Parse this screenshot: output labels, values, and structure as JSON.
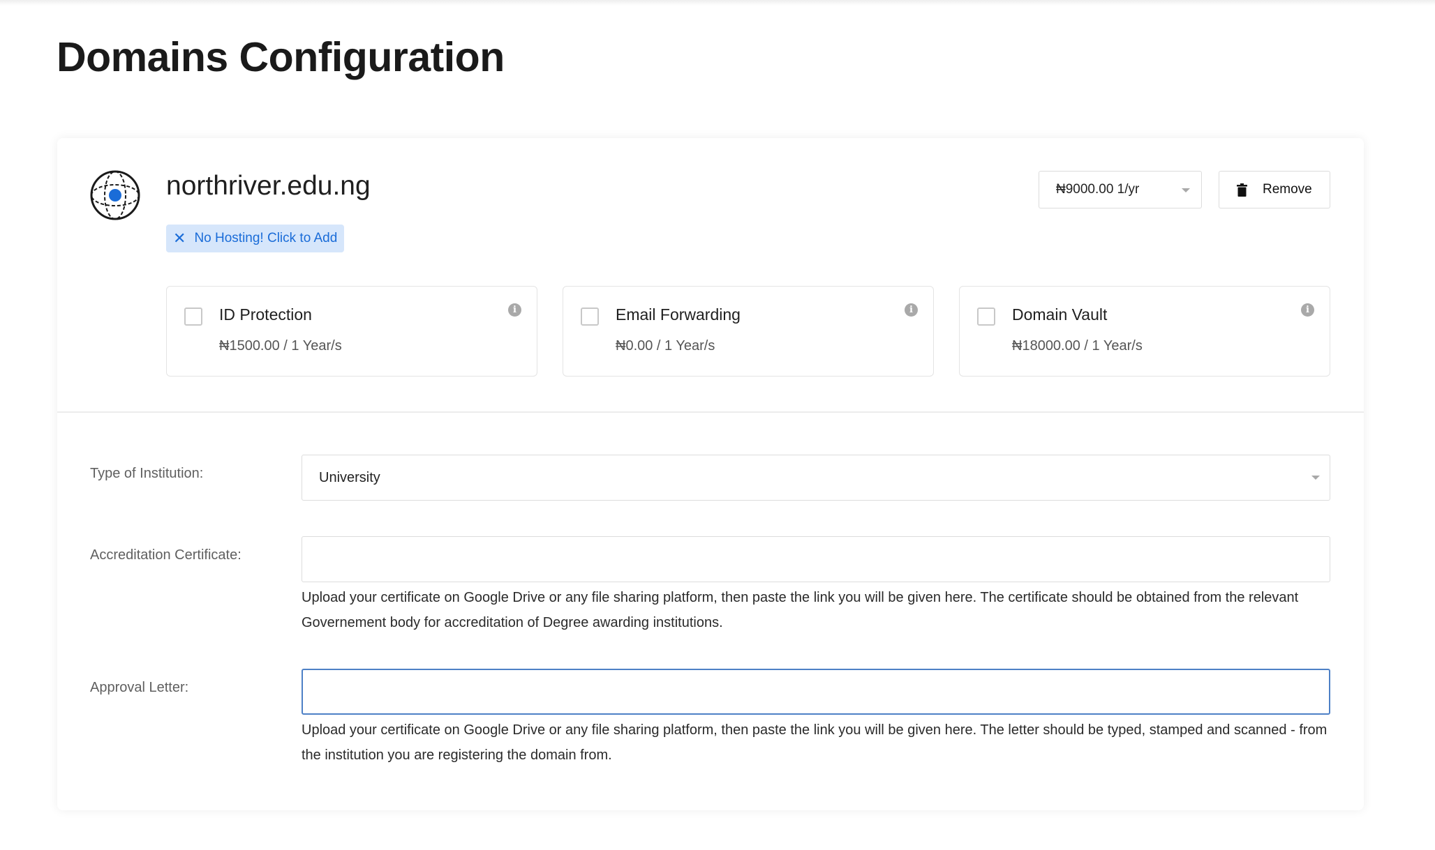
{
  "page": {
    "title": "Domains Configuration"
  },
  "domain": {
    "name": "northriver.edu.ng",
    "hosting_badge": "No Hosting! Click to Add",
    "price_selected": "₦9000.00 1/yr",
    "remove_label": "Remove"
  },
  "addons": [
    {
      "title": "ID Protection",
      "price": "₦1500.00 / 1 Year/s",
      "checked": false
    },
    {
      "title": "Email Forwarding",
      "price": "₦0.00 / 1 Year/s",
      "checked": false
    },
    {
      "title": "Domain Vault",
      "price": "₦18000.00 / 1 Year/s",
      "checked": false
    }
  ],
  "form": {
    "institution_type": {
      "label": "Type of Institution:",
      "value": "University"
    },
    "accreditation": {
      "label": "Accreditation Certificate:",
      "value": "",
      "help": "Upload your certificate on Google Drive or any file sharing platform, then paste the link you will be given here. The certificate should be obtained from the relevant Governement body for accreditation of Degree awarding institutions."
    },
    "approval_letter": {
      "label": "Approval Letter:",
      "value": "",
      "help": "Upload your certificate on Google Drive or any file sharing platform, then paste the link you will be given here. The letter should be typed, stamped and scanned - from the institution you are registering the domain from."
    }
  },
  "colors": {
    "accent": "#1a6cd8",
    "badge_bg": "#d6e6fb",
    "focus_border": "#4d80c6"
  }
}
